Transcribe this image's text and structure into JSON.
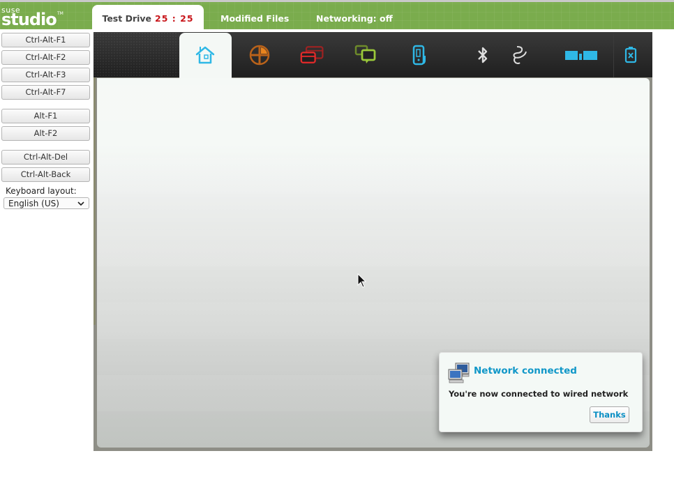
{
  "header": {
    "logo": {
      "top": "suse",
      "main": "studio",
      "tm": "TM"
    },
    "tabs": [
      {
        "label": "Test Drive",
        "timer": "25 : 25",
        "active": true
      },
      {
        "label": "Modified Files",
        "active": false
      },
      {
        "label": "Networking: off",
        "active": false
      }
    ]
  },
  "sidebar": {
    "buttons_group1": [
      "Ctrl-Alt-F1",
      "Ctrl-Alt-F2",
      "Ctrl-Alt-F3",
      "Ctrl-Alt-F7"
    ],
    "buttons_group2": [
      "Alt-F1",
      "Alt-F2"
    ],
    "buttons_group3": [
      "Ctrl-Alt-Del",
      "Ctrl-Alt-Back"
    ],
    "keyboard_label": "Keyboard layout:",
    "keyboard_selected": "English (US)"
  },
  "vm": {
    "panel_icons": [
      {
        "name": "home-icon",
        "color": "#2fb8e6",
        "active": true
      },
      {
        "name": "applications-icon",
        "color": "#d8741a"
      },
      {
        "name": "windows-icon",
        "color": "#e52a2a"
      },
      {
        "name": "chat-icon",
        "color": "#9ac83a"
      },
      {
        "name": "phone-icon",
        "color": "#2fb8e6"
      },
      {
        "name": "bluetooth-icon",
        "color": "#dddddd"
      },
      {
        "name": "network-cable-icon",
        "color": "#dddddd"
      },
      {
        "name": "signal-bars-icon",
        "color": "#2fb8e6"
      },
      {
        "name": "battery-icon",
        "color": "#2fb8e6"
      }
    ],
    "notification": {
      "title": "Network connected",
      "body": "You're now connected to wired network",
      "button": "Thanks"
    }
  }
}
